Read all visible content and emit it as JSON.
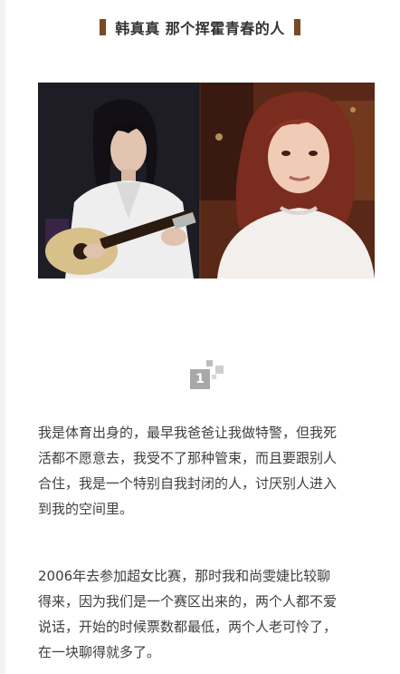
{
  "header": {
    "title": "韩真真 那个挥霍青春的人",
    "accent_color": "#7a4a22"
  },
  "section_number": "1",
  "paragraphs": [
    {
      "lines": [
        "我是体育出身的，最早我爸爸让我做特警，但我死",
        "活都不愿意去，我受不了那种管束，而且要跟别人",
        "合住，我是一个特别自我封闭的人，讨厌别人进入",
        "到我的空间里。"
      ]
    },
    {
      "lines": [
        "2006年去参加超女比赛，那时我和尚雯婕比较聊",
        "得来，因为我们是一个赛区出来的，两个人都不爱",
        "说话，开始的时候票数都最低，两个人老可怜了，",
        "在一块聊得就多了。"
      ]
    }
  ]
}
